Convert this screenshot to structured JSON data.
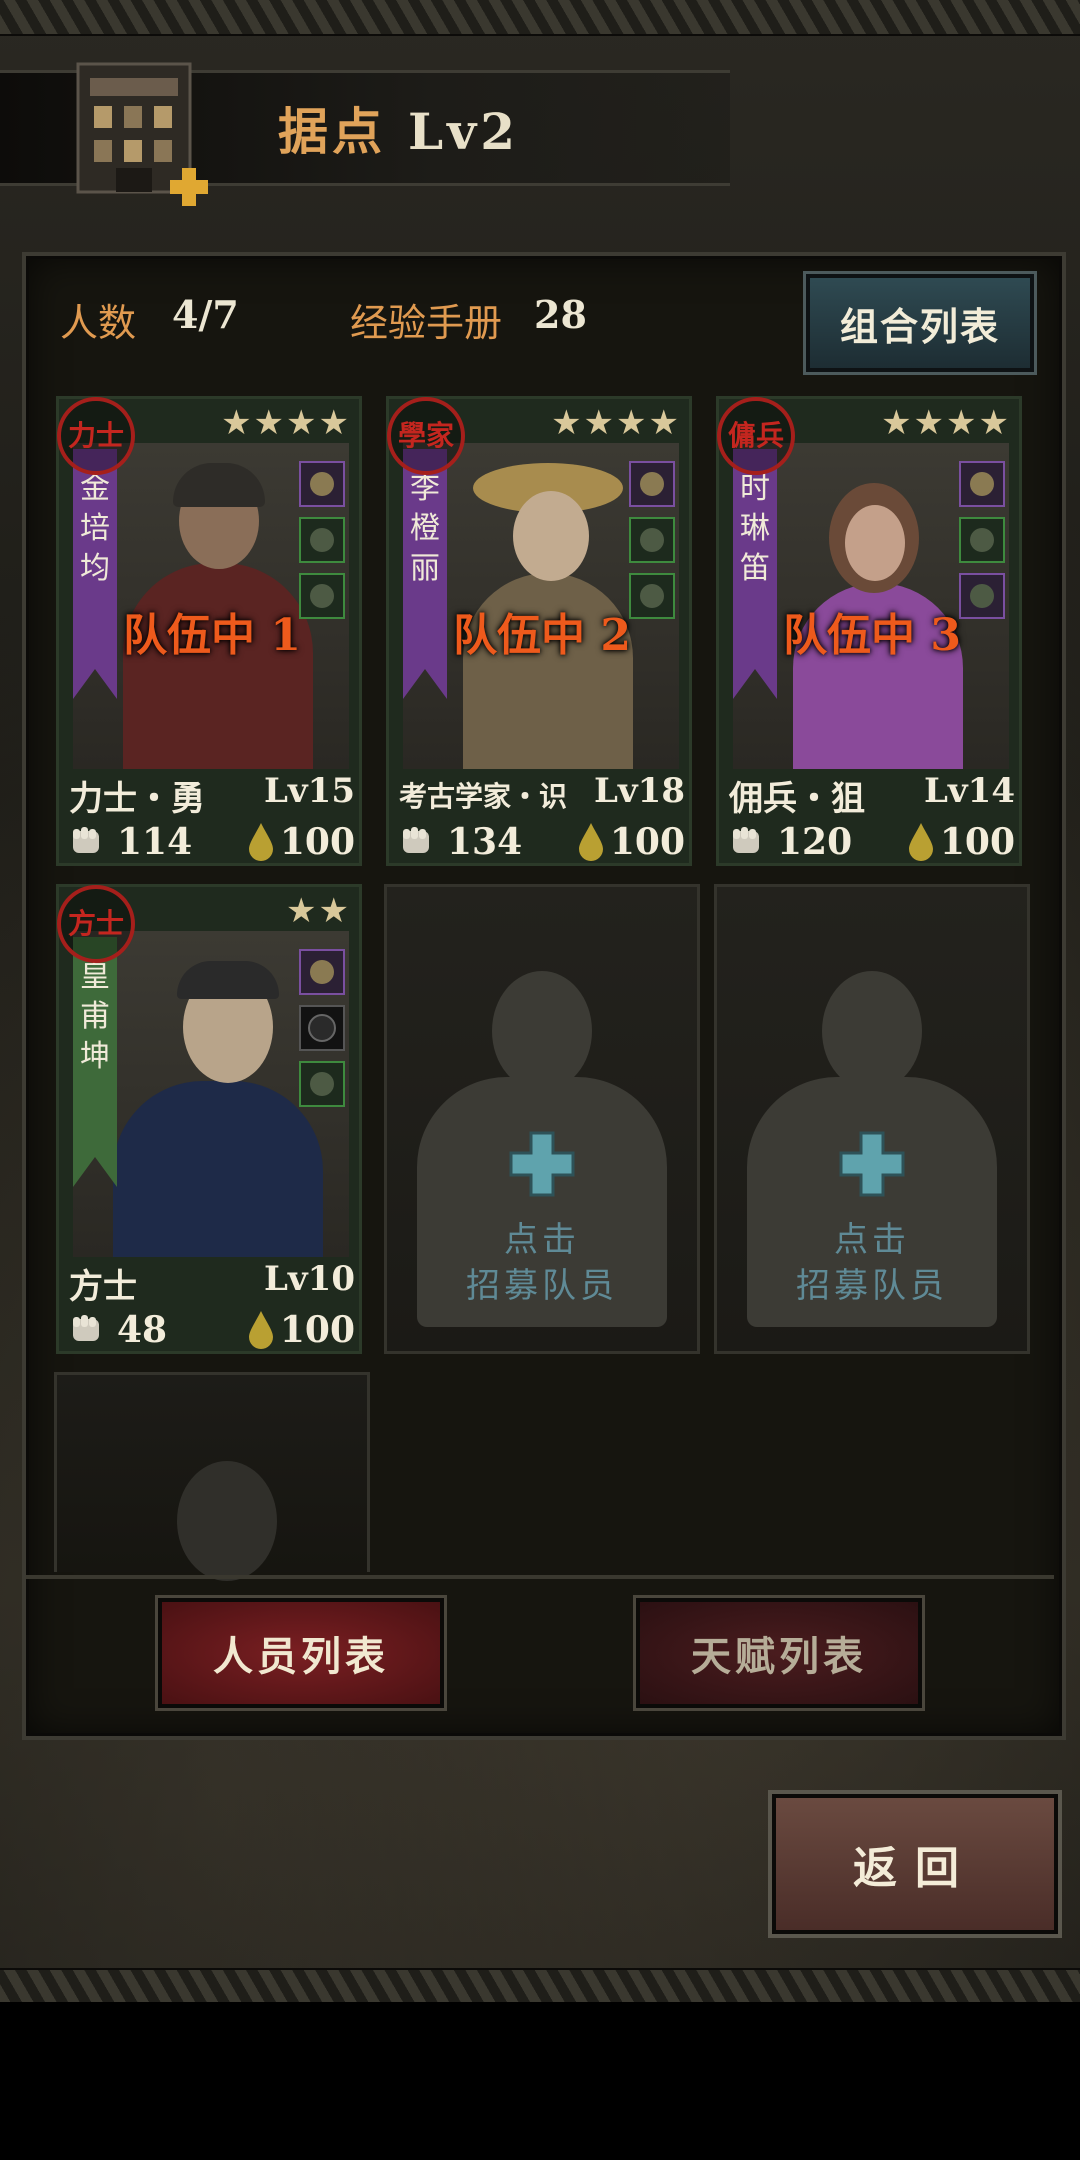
{
  "header": {
    "title": "据点",
    "level": "Lv2"
  },
  "stats": {
    "count_label": "人数",
    "count_value": "4/7",
    "exp_label": "经验手册",
    "exp_value": "28"
  },
  "combo_button": "组合列表",
  "members": [
    {
      "seal": "力士",
      "name_chars": [
        "金",
        "培",
        "均"
      ],
      "stars": "★★★★",
      "team": "队伍中 1",
      "class": "力士・勇",
      "level": "Lv15",
      "power": "114",
      "stamina": "100",
      "banner_color": "#6a3a8a"
    },
    {
      "seal": "學家",
      "name_chars": [
        "李",
        "橙",
        "丽"
      ],
      "stars": "★★★★",
      "team": "队伍中 2",
      "class": "考古学家・识",
      "level": "Lv18",
      "power": "134",
      "stamina": "100",
      "banner_color": "#6a3a8a"
    },
    {
      "seal": "傭兵",
      "name_chars": [
        "时",
        "琳",
        "笛"
      ],
      "stars": "★★★★",
      "team": "队伍中 3",
      "class": "佣兵・狙",
      "level": "Lv14",
      "power": "120",
      "stamina": "100",
      "banner_color": "#6a3a8a"
    },
    {
      "seal": "方士",
      "name_chars": [
        "皇",
        "甫",
        "坤"
      ],
      "stars": "★★",
      "team": "",
      "class": "方士",
      "level": "Lv10",
      "power": "48",
      "stamina": "100",
      "banner_color": "#3e6a3a"
    }
  ],
  "recruit": {
    "line1": "点击",
    "line2": "招募队员"
  },
  "tabs": {
    "members": "人员列表",
    "talents": "天赋列表"
  },
  "back_button": "返回"
}
